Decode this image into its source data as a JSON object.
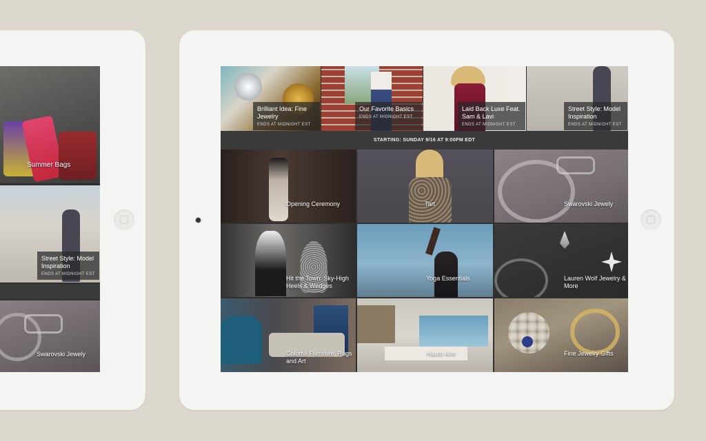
{
  "left_device": {
    "tiles": [
      {
        "label": "Summer Bags"
      },
      {
        "title": "Street Style: Model Inspiration",
        "subtitle": "ENDS AT MIDNIGHT EST"
      },
      {
        "label": "Swarovski Jewely"
      }
    ]
  },
  "right_device": {
    "top_row": [
      {
        "title": "Brilliant Idea: Fine Jewelry",
        "subtitle": "ENDS AT MIDNIGHT EST"
      },
      {
        "title": "Our Favorite Basics",
        "subtitle": "ENDS AT MIDNIGHT EST"
      },
      {
        "title": "Laid Back Luxe Feat. Sam & Lavi",
        "subtitle": "ENDS AT MIDNIGHT EST"
      },
      {
        "title": "Street Style: Model Inspiration",
        "subtitle": "ENDS AT MIDNIGHT EST"
      }
    ],
    "banner": "STARTING: SUNDAY 9/16 AT 9:00PM EDT",
    "grid": [
      {
        "label": "Opening Ceremony"
      },
      {
        "label": "Tart"
      },
      {
        "label": "Swarovski Jewely"
      },
      {
        "label": "Hit the Town: Sky-High Heels & Wedges"
      },
      {
        "label": "Yoga Essentials"
      },
      {
        "label": "Lauren Wolf Jewelry & More"
      },
      {
        "label": "Colorful Furniture, Rugs and Art"
      },
      {
        "label": "Haute Aire"
      },
      {
        "label": "Fine Jewelry Gifts"
      }
    ]
  }
}
